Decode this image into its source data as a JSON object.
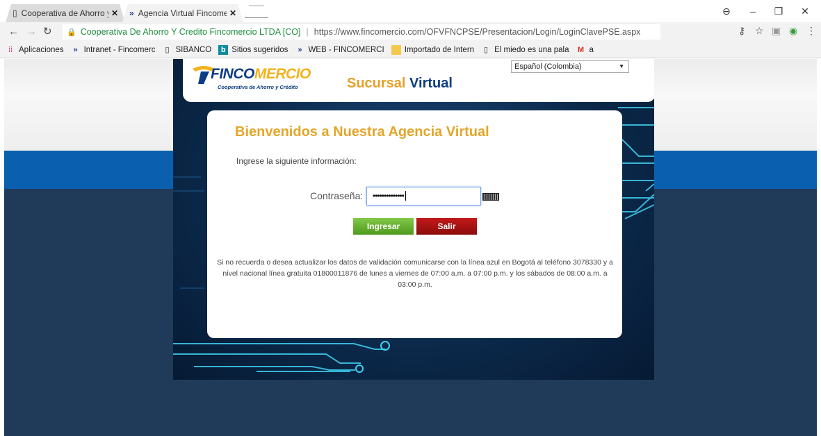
{
  "browser": {
    "tabs": [
      {
        "title": "Cooperativa de Ahorro y",
        "active": false
      },
      {
        "title": "Agencia Virtual Fincomer",
        "active": true
      }
    ],
    "tab_close": "✕",
    "address": {
      "site_name": "Cooperativa De Ahorro Y Credito Fincomercio LTDA [CO]",
      "separator": "|",
      "url": "https://www.fincomercio.com/OFVFNCPSE/Presentacion/Login/LoginClavePSE.aspx"
    },
    "bookmarks": [
      {
        "label": "Aplicaciones",
        "icon": "apps-grid-icon"
      },
      {
        "label": "Intranet - Fincomerc",
        "icon": "fincomercio-icon"
      },
      {
        "label": "SIBANCO",
        "icon": "page-icon"
      },
      {
        "label": "Sitios sugeridos",
        "icon": "bing-icon"
      },
      {
        "label": "WEB - FINCOMERCI",
        "icon": "fincomercio-icon"
      },
      {
        "label": "Importado de Intern",
        "icon": "folder-icon"
      },
      {
        "label": "El miedo es una pala",
        "icon": "page-icon"
      },
      {
        "label": "a",
        "icon": "gmail-icon"
      }
    ]
  },
  "header": {
    "logo_part1": "FINCO",
    "logo_part2": "MERCIO",
    "logo_tagline": "Cooperativa de Ahorro y Crédito",
    "brand_word1": "Sucursal",
    "brand_word2": "Virtual",
    "language": "Español (Colombia)"
  },
  "login": {
    "welcome": "Bienvenidos a Nuestra Agencia Virtual",
    "instruction": "Ingrese la siguiente información:",
    "password_label": "Contraseña:",
    "password_value": "••••••••••••••",
    "submit_label": "Ingresar",
    "exit_label": "Salir",
    "help_text": "Si no recuerda o desea actualizar los datos de validación comunicarse con la línea azul en Bogotá al teléfono 3078330 y a nivel nacional línea gratuita 01800011876 de lunes a viernes de 07:00 a.m. a 07:00 p.m. y los sábados de 08:00 a.m. a 03:00 p.m."
  },
  "colors": {
    "brand_blue": "#0d3c85",
    "brand_gold": "#e4a62a",
    "button_green": "#5fae2a",
    "button_red": "#a01010"
  }
}
